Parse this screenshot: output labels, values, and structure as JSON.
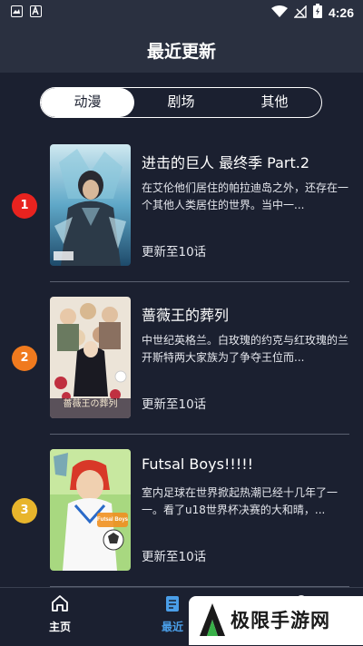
{
  "status_bar": {
    "time": "4:26"
  },
  "header": {
    "title": "最近更新"
  },
  "tabs": [
    {
      "label": "动漫",
      "active": true
    },
    {
      "label": "剧场",
      "active": false
    },
    {
      "label": "其他",
      "active": false
    }
  ],
  "items": [
    {
      "rank": "1",
      "rank_color": "#e8231f",
      "title": "进击的巨人 最终季 Part.2",
      "description": "在艾伦他们居住的帕拉迪岛之外，还存在一个其他人类居住的世界。当中一...",
      "update": "更新至10话",
      "cover_text": ""
    },
    {
      "rank": "2",
      "rank_color": "#f07a1e",
      "title": "蔷薇王的葬列",
      "description": "中世纪英格兰。白玫瑰的约克与红玫瑰的兰开斯特两大家族为了争夺王位而...",
      "update": "更新至10话",
      "cover_text": "薔薇王の葬列"
    },
    {
      "rank": "3",
      "rank_color": "#e8b52c",
      "title": "Futsal Boys!!!!!",
      "description": "室内足球在世界掀起热潮已经十几年了一一。看了u18世界杯决赛的大和晴，...",
      "update": "更新至10话",
      "cover_text": "Futsal Boys"
    }
  ],
  "bottom_nav": [
    {
      "label": "主页",
      "icon": "home-icon",
      "active": false
    },
    {
      "label": "最近",
      "icon": "list-icon",
      "active": true
    },
    {
      "label": "",
      "icon": "user-icon",
      "active": false
    }
  ],
  "watermark": {
    "text": "极限手游网"
  },
  "colors": {
    "background": "#1b2030",
    "header": "#2a3040",
    "active_nav": "#4a9ee8"
  }
}
